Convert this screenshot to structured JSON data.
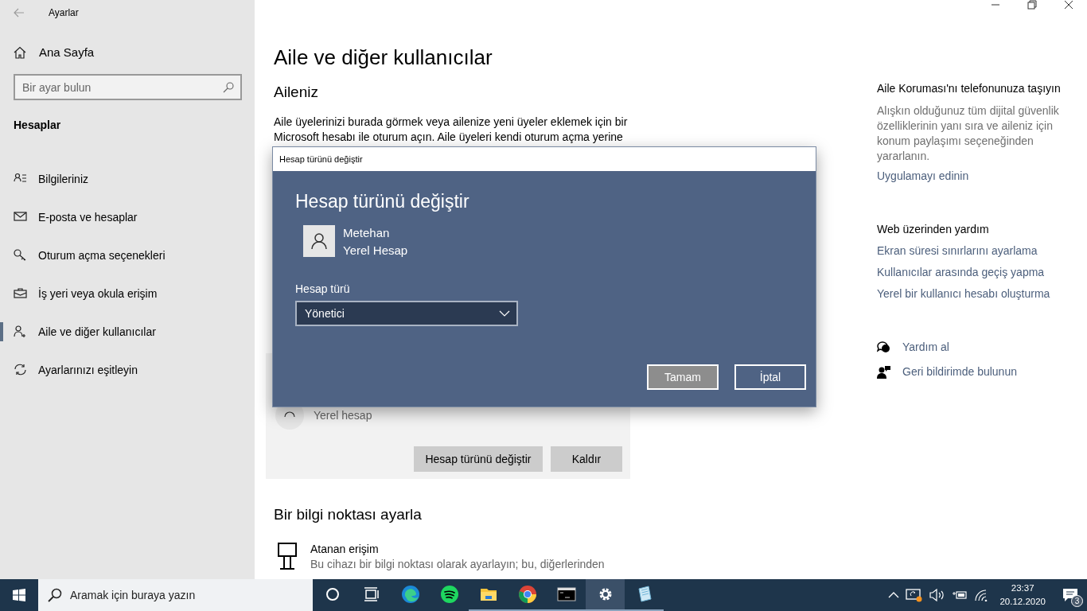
{
  "window": {
    "title": "Ayarlar"
  },
  "sidebar": {
    "home": "Ana Sayfa",
    "search": {
      "placeholder": "Bir ayar bulun"
    },
    "section": "Hesaplar",
    "items": [
      {
        "label": "Bilgileriniz",
        "kind": "info",
        "selected": false
      },
      {
        "label": "E-posta ve hesaplar",
        "kind": "mail",
        "selected": false
      },
      {
        "label": "Oturum açma seçenekleri",
        "kind": "key",
        "selected": false
      },
      {
        "label": "İş yeri veya okula erişim",
        "kind": "briefcase",
        "selected": false
      },
      {
        "label": "Aile ve diğer kullanıcılar",
        "kind": "family",
        "selected": true
      },
      {
        "label": "Ayarlarınızı eşitleyin",
        "kind": "sync",
        "selected": false
      }
    ]
  },
  "main": {
    "title": "Aile ve diğer kullanıcılar",
    "family_heading": "Aileniz",
    "family_text": [
      "Aile üyelerinizi burada görmek veya ailenize yeni üyeler eklemek için bir",
      "Microsoft hesabı ile oturum açın. Aile üyeleri kendi oturum açma yerine"
    ],
    "user_card": {
      "account_type": "Yerel hesap",
      "buttons": [
        "Hesap türünü değiştir",
        "Kaldır"
      ]
    },
    "kiosk_heading": "Bir bilgi noktası ayarla",
    "kiosk": {
      "title": "Atanan erişim",
      "description": "Bu cihazı bir bilgi noktası olarak ayarlayın; bu, diğerlerinden"
    }
  },
  "side_panel": {
    "family_safety": {
      "title": "Aile Koruması'nı telefonunuza taşıyın",
      "text": [
        "Alışkın olduğunuz tüm dijital güvenlik",
        "özelliklerinin yanı sıra ve aileniz için",
        "konum paylaşımı seçeneğinden",
        "yararlanın."
      ],
      "link": "Uygulamayı edinin"
    },
    "web_help": {
      "title": "Web üzerinden yardım",
      "links": [
        "Ekran süresi sınırlarını ayarlama",
        "Kullanıcılar arasında geçiş yapma",
        "Yerel bir kullanıcı hesabı oluşturma"
      ]
    },
    "actions": [
      {
        "label": "Yardım al",
        "kind": "help"
      },
      {
        "label": "Geri bildirimde bulunun",
        "kind": "feedback"
      }
    ]
  },
  "dialog": {
    "title": "Hesap türünü değiştir",
    "heading": "Hesap türünü değiştir",
    "user": {
      "name": "Metehan",
      "type": "Yerel Hesap"
    },
    "field_label": "Hesap türü",
    "field_value": "Yönetici",
    "buttons": [
      {
        "label": "Tamam",
        "kind": "default"
      },
      {
        "label": "İptal",
        "kind": "normal"
      }
    ]
  },
  "taskbar": {
    "search": {
      "placeholder": "Aramak için buraya yazın"
    },
    "apps": [
      {
        "kind": "cortana",
        "running": false,
        "selected": false
      },
      {
        "kind": "taskview",
        "running": false,
        "selected": false
      },
      {
        "kind": "edge",
        "running": false,
        "selected": false
      },
      {
        "kind": "spotify",
        "running": false,
        "selected": false
      },
      {
        "kind": "explorer",
        "running": true,
        "selected": false
      },
      {
        "kind": "chrome",
        "running": true,
        "selected": false
      },
      {
        "kind": "terminal",
        "running": true,
        "selected": false
      },
      {
        "kind": "settings",
        "running": true,
        "selected": true
      },
      {
        "kind": "notepad",
        "running": true,
        "selected": false
      }
    ],
    "time": "23:37",
    "date": "20.12.2020",
    "notifications": "3"
  }
}
